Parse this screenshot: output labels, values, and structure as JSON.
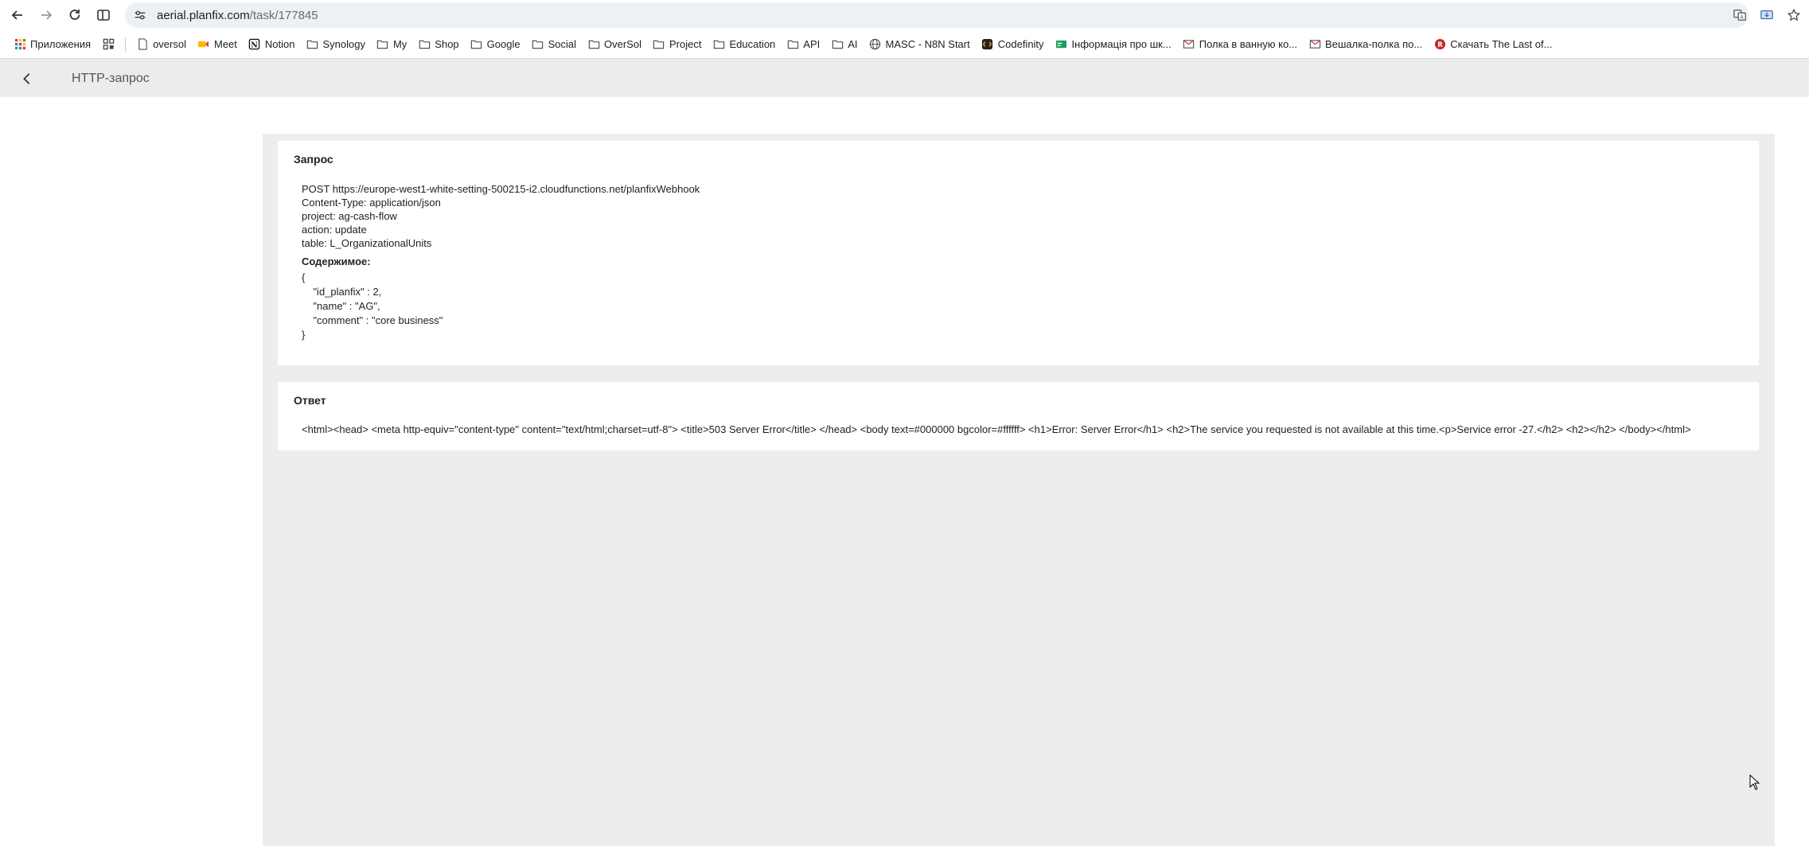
{
  "browser": {
    "url_host": "aerial.planfix.com",
    "url_path": "/task/177845",
    "bookmarks": [
      {
        "label": "Приложения",
        "icon": "apps-grid-icon"
      },
      {
        "label": "",
        "icon": "tab-groups-icon"
      },
      {
        "label": "oversol",
        "icon": "page-icon"
      },
      {
        "label": "Meet",
        "icon": "meet-icon"
      },
      {
        "label": "Notion",
        "icon": "notion-icon"
      },
      {
        "label": "Synology",
        "icon": "folder-icon"
      },
      {
        "label": "My",
        "icon": "folder-icon"
      },
      {
        "label": "Shop",
        "icon": "folder-icon"
      },
      {
        "label": "Google",
        "icon": "folder-icon"
      },
      {
        "label": "Social",
        "icon": "folder-icon"
      },
      {
        "label": "OverSol",
        "icon": "folder-icon"
      },
      {
        "label": "Project",
        "icon": "folder-icon"
      },
      {
        "label": "Education",
        "icon": "folder-icon"
      },
      {
        "label": "API",
        "icon": "folder-icon"
      },
      {
        "label": "AI",
        "icon": "folder-icon"
      },
      {
        "label": "MASC - N8N Start",
        "icon": "globe-icon"
      },
      {
        "label": "Codefinity",
        "icon": "codefinity-icon"
      },
      {
        "label": "Інформація про шк...",
        "icon": "green-card-icon"
      },
      {
        "label": "Полка в ванную ко...",
        "icon": "mail-icon"
      },
      {
        "label": "Вешалка-полка по...",
        "icon": "mail-icon"
      },
      {
        "label": "Скачать The Last of...",
        "icon": "red-circle-icon"
      }
    ]
  },
  "header": {
    "title": "HTTP-запрос"
  },
  "request": {
    "heading": "Запрос",
    "lines": [
      "POST https://europe-west1-white-setting-500215-i2.cloudfunctions.net/planfixWebhook",
      "Content-Type: application/json",
      "project: ag-cash-flow",
      "action: update",
      "table: L_OrganizationalUnits"
    ],
    "content_heading": "Содержимое:",
    "body_lines": [
      "{",
      "    \"id_planfix\" : 2,",
      "    \"name\" : \"AG\",",
      "    \"comment\" : \"core business\"",
      "}"
    ]
  },
  "response": {
    "heading": "Ответ",
    "text": "<html><head> <meta http-equiv=\"content-type\" content=\"text/html;charset=utf-8\"> <title>503 Server Error</title> </head> <body text=#000000 bgcolor=#ffffff> <h1>Error: Server Error</h1> <h2>The service you requested is not available at this time.<p>Service error -27.</h2> <h2></h2> </body></html>"
  },
  "colors": {
    "page_bg": "#ededed",
    "card_bg": "#ffffff",
    "omnibox_bg": "#edf0f4"
  }
}
